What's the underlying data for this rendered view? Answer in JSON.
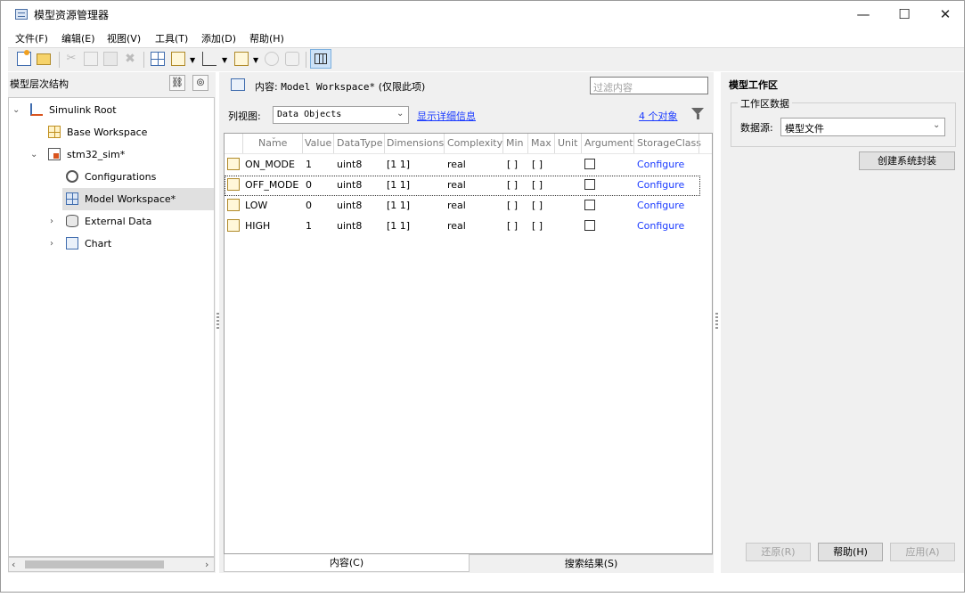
{
  "window": {
    "title": "模型资源管理器",
    "minimize": "—",
    "maximize": "☐",
    "close": "✕"
  },
  "menu": [
    "文件(F)",
    "编辑(E)",
    "视图(V)",
    "工具(T)",
    "添加(D)",
    "帮助(H)"
  ],
  "left_panel": {
    "title": "模型层次结构",
    "tree": [
      {
        "label": "Simulink Root",
        "icon": "simulink-icon",
        "expanded": true
      },
      {
        "label": "Base Workspace",
        "icon": "workspace-icon"
      },
      {
        "label": "stm32_sim*",
        "icon": "model-icon",
        "expanded": true
      },
      {
        "label": "Configurations",
        "icon": "gear-icon"
      },
      {
        "label": "Model Workspace*",
        "icon": "model-workspace-icon",
        "selected": true
      },
      {
        "label": "External Data",
        "icon": "database-icon",
        "expanded": false
      },
      {
        "label": "Chart",
        "icon": "chart-icon",
        "expanded": false
      }
    ]
  },
  "content_panel": {
    "header_prefix": "内容:",
    "header_path": "Model Workspace*",
    "header_suffix": "(仅限此项)",
    "filter_placeholder": "过滤内容",
    "view_label": "列视图:",
    "view_value": "Data Objects",
    "details_link": "显示详细信息",
    "count_link": "4 个对象",
    "columns": [
      "Name",
      "Value",
      "DataType",
      "Dimensions",
      "Complexity",
      "Min",
      "Max",
      "Unit",
      "Argument",
      "StorageClass"
    ],
    "rows": [
      {
        "name": "ON_MODE",
        "value": "1",
        "datatype": "uint8",
        "dimensions": "[1 1]",
        "complexity": "real",
        "min": "[ ]",
        "max": "[ ]",
        "unit": "",
        "argument": false,
        "storage": "Configure"
      },
      {
        "name": "OFF_MODE",
        "value": "0",
        "datatype": "uint8",
        "dimensions": "[1 1]",
        "complexity": "real",
        "min": "[ ]",
        "max": "[ ]",
        "unit": "",
        "argument": false,
        "storage": "Configure"
      },
      {
        "name": "LOW",
        "value": "0",
        "datatype": "uint8",
        "dimensions": "[1 1]",
        "complexity": "real",
        "min": "[ ]",
        "max": "[ ]",
        "unit": "",
        "argument": false,
        "storage": "Configure"
      },
      {
        "name": "HIGH",
        "value": "1",
        "datatype": "uint8",
        "dimensions": "[1 1]",
        "complexity": "real",
        "min": "[ ]",
        "max": "[ ]",
        "unit": "",
        "argument": false,
        "storage": "Configure"
      }
    ],
    "tabs": [
      "内容(C)",
      "搜索结果(S)"
    ]
  },
  "right_panel": {
    "title": "模型工作区",
    "group_title": "工作区数据",
    "source_label": "数据源:",
    "source_value": "模型文件",
    "create_button": "创建系统封装",
    "revert_button": "还原(R)",
    "help_button": "帮助(H)",
    "apply_button": "应用(A)"
  },
  "colors": {
    "link": "#1a3aff",
    "panel_bg": "#f0f0f0",
    "selection": "#e0e0e0"
  }
}
